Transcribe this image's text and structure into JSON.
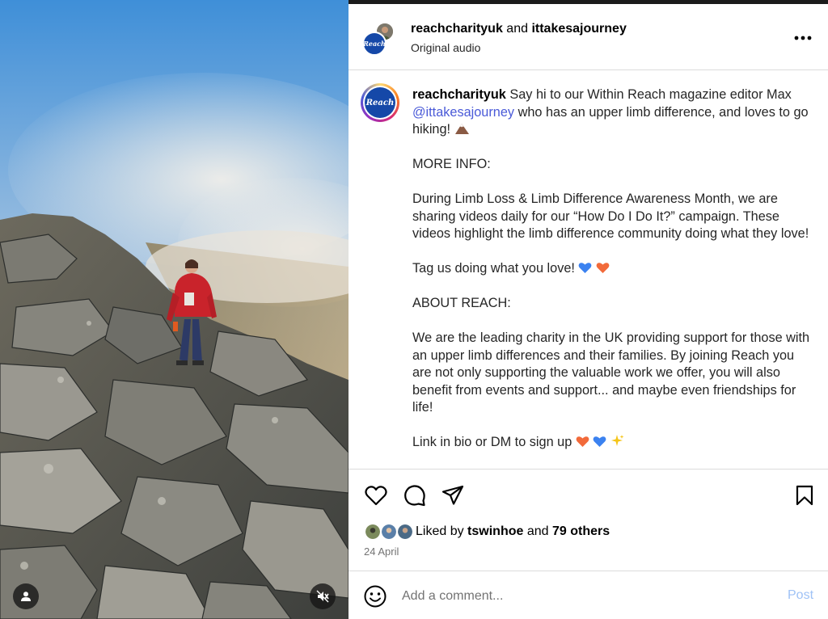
{
  "header": {
    "author": "reachcharityuk",
    "connector": "and",
    "collaborator": "ittakesajourney",
    "audio_label": "Original audio",
    "avatar_text": "Reach"
  },
  "caption": {
    "username": "reachcharityuk",
    "intro": "Say hi to our Within Reach magazine editor Max",
    "mention": "@ittakesajourney",
    "intro_rest": "who has an upper limb difference, and loves to go hiking!",
    "more_info_heading": "MORE INFO:",
    "more_info_body": "During Limb Loss & Limb Difference Awareness Month, we are sharing videos daily for our “How Do I Do It?” campaign. These videos highlight the limb difference community doing what they love!",
    "tag_line": "Tag us doing what you love!",
    "about_heading": "ABOUT REACH:",
    "about_body": "We are the leading charity in the UK providing support for those with an upper limb differences and their families. By joining Reach you are not only supporting the valuable work we offer, you will also benefit from events and support... and maybe even friendships for life!",
    "signup_line": "Link in bio or DM to sign up"
  },
  "likes": {
    "prefix": "Liked by",
    "user": "tswinhoe",
    "connector": "and",
    "others": "79 others"
  },
  "date": "24 April",
  "comment": {
    "placeholder": "Add a comment...",
    "post_label": "Post"
  },
  "icons": [
    "user-tag-icon",
    "mute-icon",
    "more-options-icon",
    "heart-icon",
    "comment-icon",
    "share-icon",
    "bookmark-icon",
    "emoji-icon",
    "mountain-emoji-icon",
    "blue-heart-icon",
    "orange-heart-icon",
    "sparkles-icon"
  ],
  "colors": {
    "mention": "#4a5ad8",
    "post_button": "#9fc2f6",
    "reach_brand": "#1548a8",
    "muted_text": "#737373"
  }
}
